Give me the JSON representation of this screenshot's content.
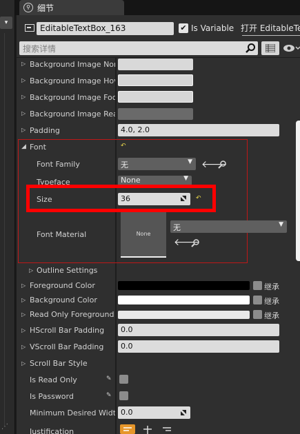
{
  "tab": {
    "label": "细节"
  },
  "header": {
    "widget_name": "EditableTextBox_163",
    "is_variable_checked": true,
    "is_variable_label": "Is Variable",
    "open_label": "打开 EditableTe"
  },
  "search": {
    "placeholder": "搜索详情"
  },
  "rows": {
    "bg_image_normal": "Background Image Norm",
    "bg_image_hovered": "Background Image Hove",
    "bg_image_focused": "Background Image Focus",
    "bg_image_readonly": "Background Image Read",
    "padding_label": "Padding",
    "padding_value": "4.0, 2.0",
    "font_label": "Font",
    "font_family_label": "Font Family",
    "font_family_value": "无",
    "typeface_label": "Typeface",
    "typeface_value": "None",
    "size_label": "Size",
    "size_value": "36",
    "font_material_label": "Font Material",
    "font_material_thumb": "None",
    "font_material_value": "无",
    "outline_label": "Outline Settings",
    "fg_color_label": "Foreground Color",
    "bg_color_label": "Background Color",
    "ro_fg_color_label": "Read Only Foreground Co",
    "inherit_label": "继承",
    "hscroll_label": "HScroll Bar Padding",
    "hscroll_value": "0.0",
    "vscroll_label": "VScroll Bar Padding",
    "vscroll_value": "0.0",
    "scroll_style_label": "Scroll Bar Style",
    "is_read_only_label": "Is Read Only",
    "is_password_label": "Is Password",
    "min_width_label": "Minimum Desired Width",
    "min_width_value": "0.0",
    "justification_label": "Justification"
  },
  "colors": {
    "accent_orange": "#e6962a",
    "highlight_red": "#ff0000",
    "reset_yellow": "#e6d44a"
  }
}
